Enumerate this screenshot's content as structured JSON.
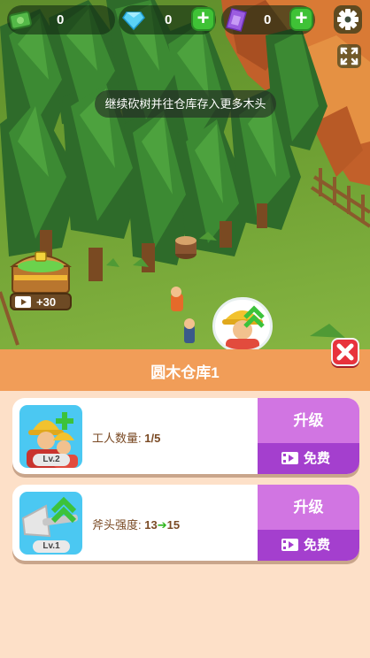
{
  "hud": {
    "cash": {
      "icon": "cash-icon",
      "value": "0"
    },
    "diamond": {
      "icon": "diamond-icon",
      "value": "0"
    },
    "ticket": {
      "icon": "ticket-icon",
      "value": "0"
    },
    "plus_label": "+"
  },
  "tip_text": "继续砍树并往仓库存入更多木头",
  "chest_reward": "+30",
  "panel": {
    "title": "圆木仓库1",
    "close_icon": "close-icon",
    "cards": [
      {
        "icon": "worker-icon",
        "level": "Lv.2",
        "stat_label": "工人数量: ",
        "stat_value": "1/5",
        "upgrade_label": "升级",
        "free_label": "免费"
      },
      {
        "icon": "axe-icon",
        "level": "Lv.1",
        "stat_label": "斧头强度: ",
        "stat_from": "13",
        "stat_arrow": "➔",
        "stat_to": "15",
        "upgrade_label": "升级",
        "free_label": "免费"
      }
    ]
  },
  "colors": {
    "panel_header": "#f19d58",
    "panel_bg": "#fde0c8",
    "upgrade_light": "#d175e2",
    "upgrade_dark": "#a43fce",
    "plus_green": "#3fc236",
    "close_red": "#e8323c"
  }
}
